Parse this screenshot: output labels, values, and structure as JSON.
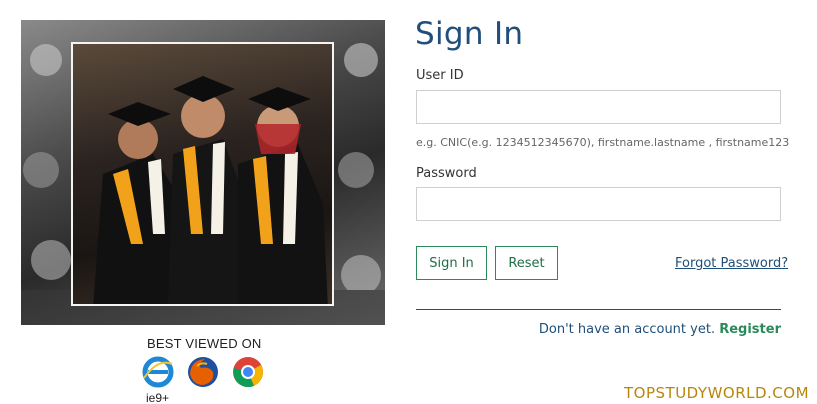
{
  "signin": {
    "title": "Sign In",
    "userid_label": "User ID",
    "userid_value": "",
    "userid_hint": "e.g. CNIC(e.g. 1234512345670), firstname.lastname , firstname123",
    "password_label": "Password",
    "password_value": "",
    "signin_button": "Sign In",
    "reset_button": "Reset",
    "forgot_link": "Forgot Password?",
    "no_account_text": "Don't have an account yet.",
    "register_link": "Register"
  },
  "browsers": {
    "label": "BEST VIEWED ON",
    "items": [
      {
        "icon": "internet-explorer-icon",
        "note": "ie9+",
        "color": "#1e88d6"
      },
      {
        "icon": "firefox-icon",
        "color": "#e66000"
      },
      {
        "icon": "chrome-icon",
        "color": "#db4437"
      }
    ]
  },
  "watermark": "TOPSTUDYWORLD.COM",
  "colors": {
    "title": "#1f4f7a",
    "accent_green": "#2c8a5a",
    "watermark": "#b8860b"
  }
}
